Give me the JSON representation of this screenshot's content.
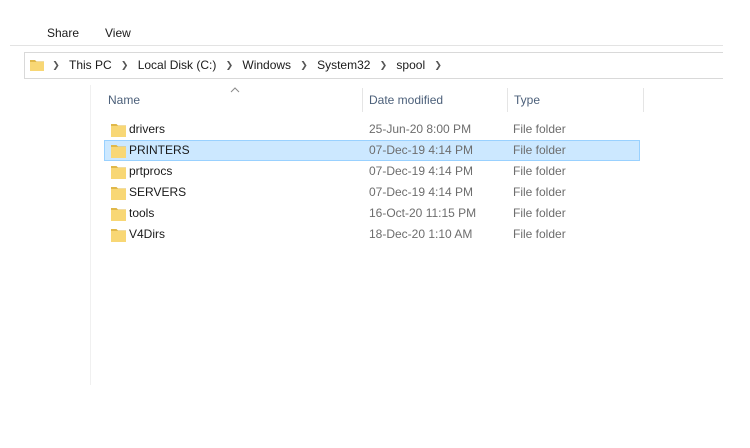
{
  "ribbon": {
    "tabs": [
      "Share",
      "View"
    ]
  },
  "address": {
    "folder_icon": "folder-icon",
    "separator_icon": "chevron-right-icon",
    "crumbs": [
      "This PC",
      "Local Disk (C:)",
      "Windows",
      "System32",
      "spool"
    ]
  },
  "columns": {
    "name": "Name",
    "date": "Date modified",
    "type": "Type",
    "sort_icon": "sort-up-icon"
  },
  "files": [
    {
      "name": "drivers",
      "date": "25-Jun-20 8:00 PM",
      "type": "File folder",
      "selected": false
    },
    {
      "name": "PRINTERS",
      "date": "07-Dec-19 4:14 PM",
      "type": "File folder",
      "selected": true
    },
    {
      "name": "prtprocs",
      "date": "07-Dec-19 4:14 PM",
      "type": "File folder",
      "selected": false
    },
    {
      "name": "SERVERS",
      "date": "07-Dec-19 4:14 PM",
      "type": "File folder",
      "selected": false
    },
    {
      "name": "tools",
      "date": "16-Oct-20 11:15 PM",
      "type": "File folder",
      "selected": false
    },
    {
      "name": "V4Dirs",
      "date": "18-Dec-20 1:10 AM",
      "type": "File folder",
      "selected": false
    }
  ],
  "colors": {
    "folder": "#f8d775",
    "folder_dark": "#e0b84a",
    "selection_bg": "#cce8ff",
    "selection_border": "#99d1ff"
  }
}
